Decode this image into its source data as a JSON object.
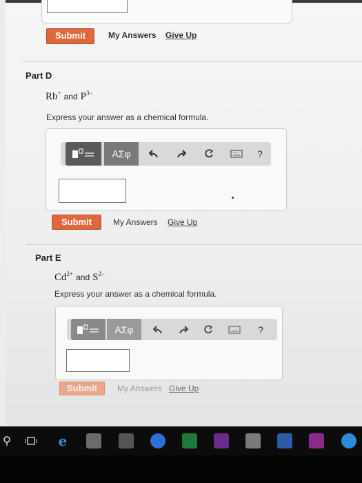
{
  "previous_part": {
    "submit_label": "Submit",
    "my_answers_label": "My Answers",
    "give_up_label": "Give Up"
  },
  "part_d": {
    "title": "Part D",
    "ion1": "Rb",
    "ion1_charge": "+",
    "and_word": "and",
    "ion2": "P",
    "ion2_charge": "3−",
    "prompt": "Express your answer as a chemical formula.",
    "greek_label": "ΑΣφ",
    "help_label": "?",
    "answer_value": "",
    "submit_label": "Submit",
    "my_answers_label": "My Answers",
    "give_up_label": "Give Up"
  },
  "part_e": {
    "title": "Part E",
    "ion1": "Cd",
    "ion1_charge": "2+",
    "and_word": "and",
    "ion2": "S",
    "ion2_charge": "2−",
    "prompt": "Express your answer as a chemical formula.",
    "greek_label": "ΑΣφ",
    "help_label": "?",
    "answer_value": "",
    "submit_label": "Submit",
    "my_answers_label": "My Answers",
    "give_up_label": "Give Up"
  },
  "colors": {
    "submit_button": "#e0663b",
    "toolbar": "#d9d9d9"
  },
  "taskbar": {
    "icons": [
      "search-icon",
      "task-view-icon",
      "edge-icon",
      "file-explorer-icon",
      "store-icon",
      "chrome-icon",
      "excel-icon",
      "onenote-icon",
      "outlook-icon",
      "word-icon",
      "powerpoint-icon",
      "skype-icon"
    ]
  }
}
